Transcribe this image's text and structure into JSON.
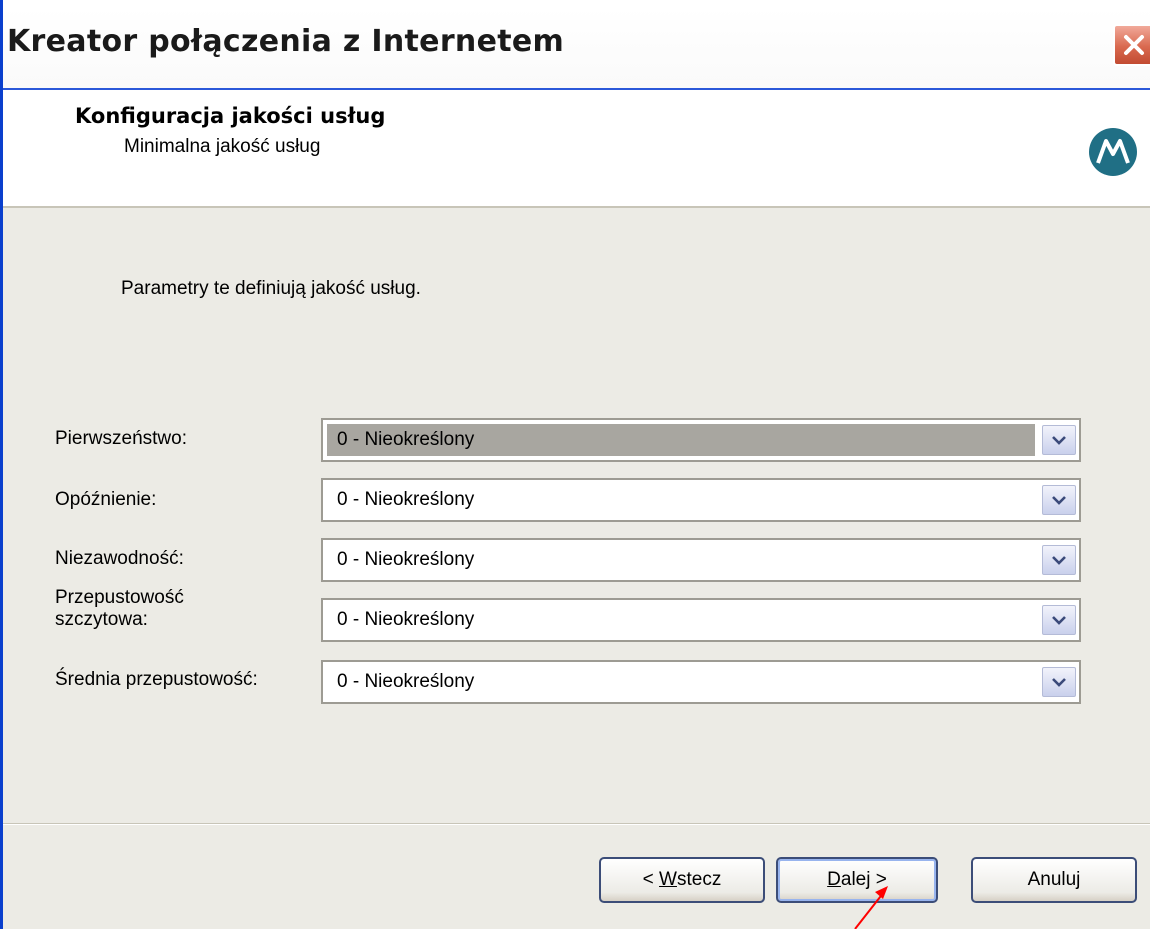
{
  "window": {
    "title": "Kreator połączenia z Internetem",
    "close_icon": "close-icon"
  },
  "header": {
    "title": "Konfiguracja jakości usług",
    "subtitle": "Minimalna jakość usług",
    "logo_icon": "motorola-logo-icon",
    "logo_color": "#206f85"
  },
  "body": {
    "intro": "Parametry te definiują jakość usług.",
    "fields": [
      {
        "label": "Pierwszeństwo:",
        "value": "0 - Nieokreślony",
        "focused": true
      },
      {
        "label": "Opóźnienie:",
        "value": "0 - Nieokreślony"
      },
      {
        "label": "Niezawodność:",
        "value": "0 - Nieokreślony"
      },
      {
        "label": "Przepustowość szczytowa:",
        "value": "0 - Nieokreślony"
      },
      {
        "label": "Średnia przepustowość:",
        "value": "0 - Nieokreślony"
      }
    ]
  },
  "buttons": {
    "back": {
      "prefix": "< ",
      "mnemonic": "W",
      "rest": "stecz"
    },
    "next": {
      "mnemonic": "D",
      "rest": "alej >"
    },
    "cancel": "Anuluj"
  },
  "annotation": {
    "icon": "red-pointer-arrow",
    "color": "#ff0000"
  }
}
